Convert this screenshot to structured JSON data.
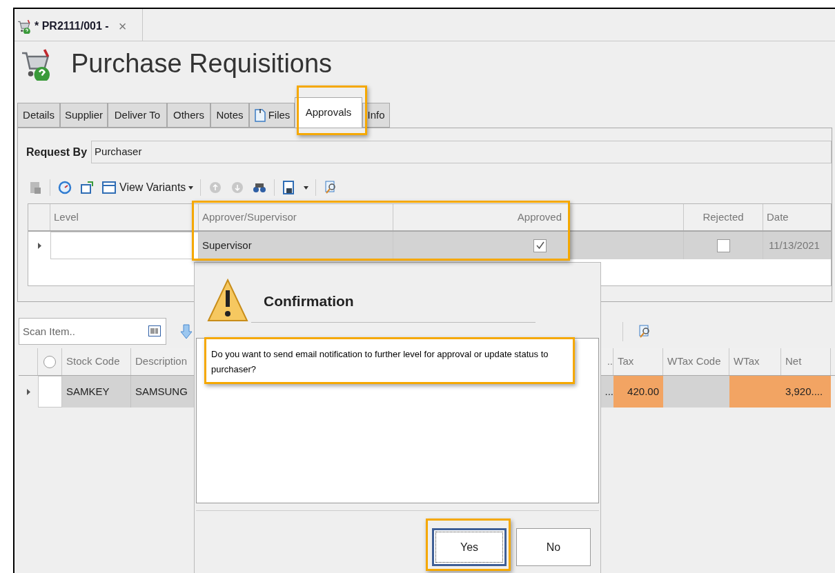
{
  "document_tab": {
    "title": "* PR2111/001 -",
    "close": "×"
  },
  "page_title": "Purchase Requisitions",
  "tabs": [
    {
      "label": "Details",
      "selected": false,
      "kind": "text"
    },
    {
      "label": "Supplier",
      "selected": false,
      "kind": "text"
    },
    {
      "label": "Deliver To",
      "selected": false,
      "kind": "text"
    },
    {
      "label": "Others",
      "selected": false,
      "kind": "text"
    },
    {
      "label": "Notes",
      "selected": false,
      "kind": "text"
    },
    {
      "label": "Files",
      "selected": false,
      "kind": "icon"
    },
    {
      "label": "Approvals",
      "selected": true,
      "kind": "text"
    },
    {
      "label": "Info",
      "selected": false,
      "kind": "text"
    }
  ],
  "request_by": {
    "label": "Request By",
    "value": "Purchaser"
  },
  "approvals_toolbar": {
    "view_variants": "View Variants"
  },
  "approvals_grid": {
    "columns": [
      "Level",
      "Approver/Supervisor",
      "Approved",
      "Rejected",
      "Date"
    ],
    "rows": [
      {
        "approver": "Supervisor",
        "approved": true,
        "rejected": false,
        "date": "11/13/2021",
        "selected": true
      }
    ]
  },
  "scan_field": {
    "placeholder": "Scan Item.."
  },
  "items_grid": {
    "select_all": {
      "checked": false
    },
    "columns": [
      "Stock Code",
      "Description",
      "..",
      "Tax",
      "WTax Code",
      "WTax",
      "Net"
    ],
    "rows": [
      {
        "stock_code": "SAMKEY",
        "description": "SAMSUNG",
        "column_3": "...",
        "tax": "420.00",
        "net": "3,920...."
      }
    ]
  },
  "dialog": {
    "title": "Confirmation",
    "message": "Do you want to send email notification to further level for approval or update status to purchaser?",
    "buttons": [
      {
        "label": "Yes",
        "focused": true
      },
      {
        "label": "No",
        "focused": false
      }
    ]
  }
}
